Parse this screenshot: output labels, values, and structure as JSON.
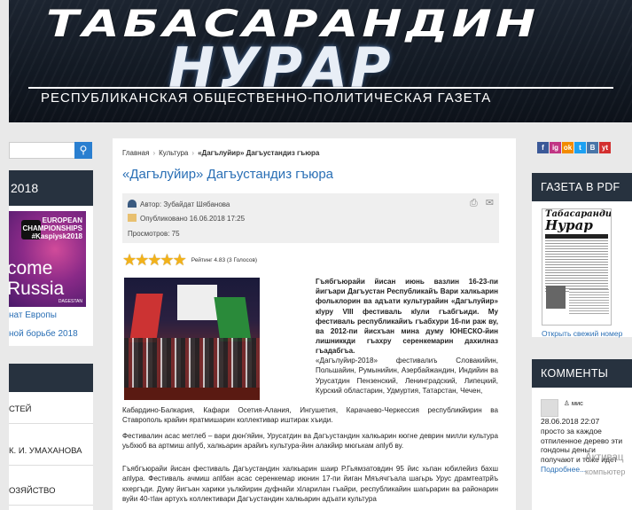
{
  "header": {
    "title_top": "ТАБАСАРАНДИН",
    "title_main": "НУРАР",
    "subtitle": "РЕСПУБЛИКАНСКАЯ ОБЩЕСТВЕННО-ПОЛИТИЧЕСКАЯ ГАЗЕТА"
  },
  "left_sidebar": {
    "search_icon": "search-icon",
    "box_head": "2018",
    "promo": {
      "line1": "EUROPEAN",
      "line2": "CHAMPIONSHIPS",
      "line3": "#Kaspiysk2018",
      "big": "come Russia",
      "dag": "DAGESTAN"
    },
    "links": [
      "нат Европы",
      "ной борьбе 2018"
    ],
    "items": [
      "СТЕЙ",
      "К. И. УМАХАНОВА",
      "ОЗЯЙСТВО"
    ]
  },
  "article": {
    "breadcrumbs": [
      "Главная",
      "Культура",
      "«Дагълуйир» Дагъустандиз гъюра"
    ],
    "title": "«Дагълуйир» Дагъустандиз гъюра",
    "author": "Автор: Зубайдат Шябанова",
    "published": "Опубликовано 16.06.2018 17:25",
    "views": "Просмотров: 75",
    "rating_text": "Рейтинг 4.83 (3 Голосов)",
    "stars": 5,
    "lead": "Гъябгъюрайи йисан июнь вазлин 16-23-пи йигъари Дагъустан Республикайъ Вари халкьарин фольклорин ва адъати культурайин «Дагълуйир» кlуру VIII фестиваль кlули гъабгъиди. Му фестиваль республикайиъ гъабхури 16-пи раж ву, ва 2012-пи йисхъан мина думу ЮНЕСКО-йин лишниккди гъахру серенкемарин дахилназ гъадабгъа.",
    "p1_start": "«Дагълуйир-2018» фестивалиъ Словакийин, Польшайин, Румынийин, Азербайжандин, Индийин ва Урусатдин Пензенский, Ленинградский, Липецкий, Курский областарин, Удмуртия, Татарстан, Чечен,",
    "p1_end": "Кабардино-Балкария, Кафари Осетия-Алания, Ингушетия, Карачаево-Черкессия республикйирин ва Ставрополь крайин яратмишарин коллективар иштирак хъиди.",
    "p2": "Фестивалин асас метлеб – вари дюн'яйин, Урусатдин ва Дагъустандин халкьарин кюгне деврин милли культура уьбхюб ва артмиш апlуб, халкьарин арайиъ культура-йин алакйир мюгькам апlуб ву.",
    "p3": "Гъябгъюрайи йисан фестиваль Дагъустандин халкьарин шаир Р.Гьямзатовдин 95 йис хьпан юбилейиз бахш апlура. Фестиваль ачмиш апlбан асас серенкемар июнин 17-пи йиган Мяъячгъала шагьрь Урус драмтеатрйъ кхергъди. Думу йигъан харики уьлкйирин дуфнайи хlларилан гъайри, республикайин шагьрарин ва районарин вуйи 40-тlан артухъ коллективари Дагъустандин халкьарин адъати культура"
  },
  "right_sidebar": {
    "social": [
      "f",
      "ig",
      "ok",
      "t",
      "B",
      "yt"
    ],
    "pdf_head": "ГАЗЕТА В PDF",
    "paper_title1": "Табасарандин",
    "paper_title2": "Нурар",
    "open_link": "Открыть свежий номер",
    "comments_head": "КОММЕНТЫ",
    "comment": {
      "user": "мис",
      "date": "28.06.2018 22:07",
      "text": "просто за каждое отпиленное дерево эти гондоны деньги получают и тоже идет",
      "more": "Подробнее..."
    },
    "watermark_line1": "Активац",
    "watermark_line2": "компьютер"
  },
  "colors": {
    "accent": "#2a6fb5",
    "dark_header": "#27323f",
    "star": "#f2b21a"
  }
}
